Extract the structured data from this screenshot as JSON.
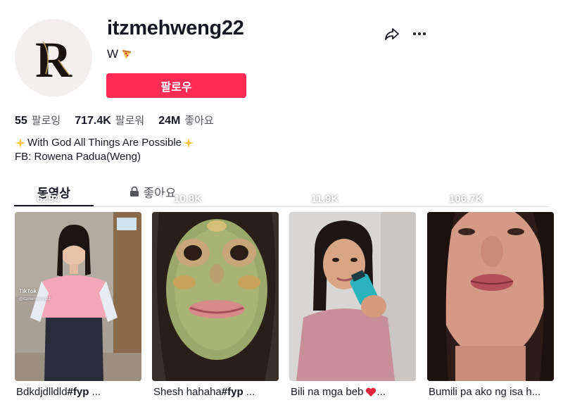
{
  "profile": {
    "username": "itzmehweng22",
    "nickname": "W",
    "follow_label": "팔로우"
  },
  "stats": [
    {
      "num": "55",
      "label": "팔로잉"
    },
    {
      "num": "717.4K",
      "label": "팔로워"
    },
    {
      "num": "24M",
      "label": "좋아요"
    }
  ],
  "bio": {
    "line1": "With God All Things Are Possible",
    "line2": "FB: Rowena Padua(Weng)"
  },
  "tabs": {
    "videos": "동영상",
    "liked": "좋아요"
  },
  "videos": [
    {
      "views": "6294",
      "caption": "Bdkdjdlldld",
      "tag": "#fyp",
      "suffix": " ...",
      "watermark": "TikTok",
      "handle": "@itzmehweng22"
    },
    {
      "views": "10.8K",
      "caption": "Shesh hahaha",
      "tag": "#fyp",
      "suffix": " ..."
    },
    {
      "views": "11.9K",
      "caption": "Bili na mga beb",
      "suffix": " ..."
    },
    {
      "views": "106.7K",
      "caption": "Bumili pa ako ng isa h..."
    }
  ],
  "colors": {
    "accent": "#fe2c55",
    "text": "#161823",
    "muted": "#57585e"
  },
  "icons": [
    "share-icon",
    "more-icon",
    "pizza-emoji",
    "sparkle-emoji",
    "lock-icon",
    "play-icon",
    "heart-emoji"
  ]
}
